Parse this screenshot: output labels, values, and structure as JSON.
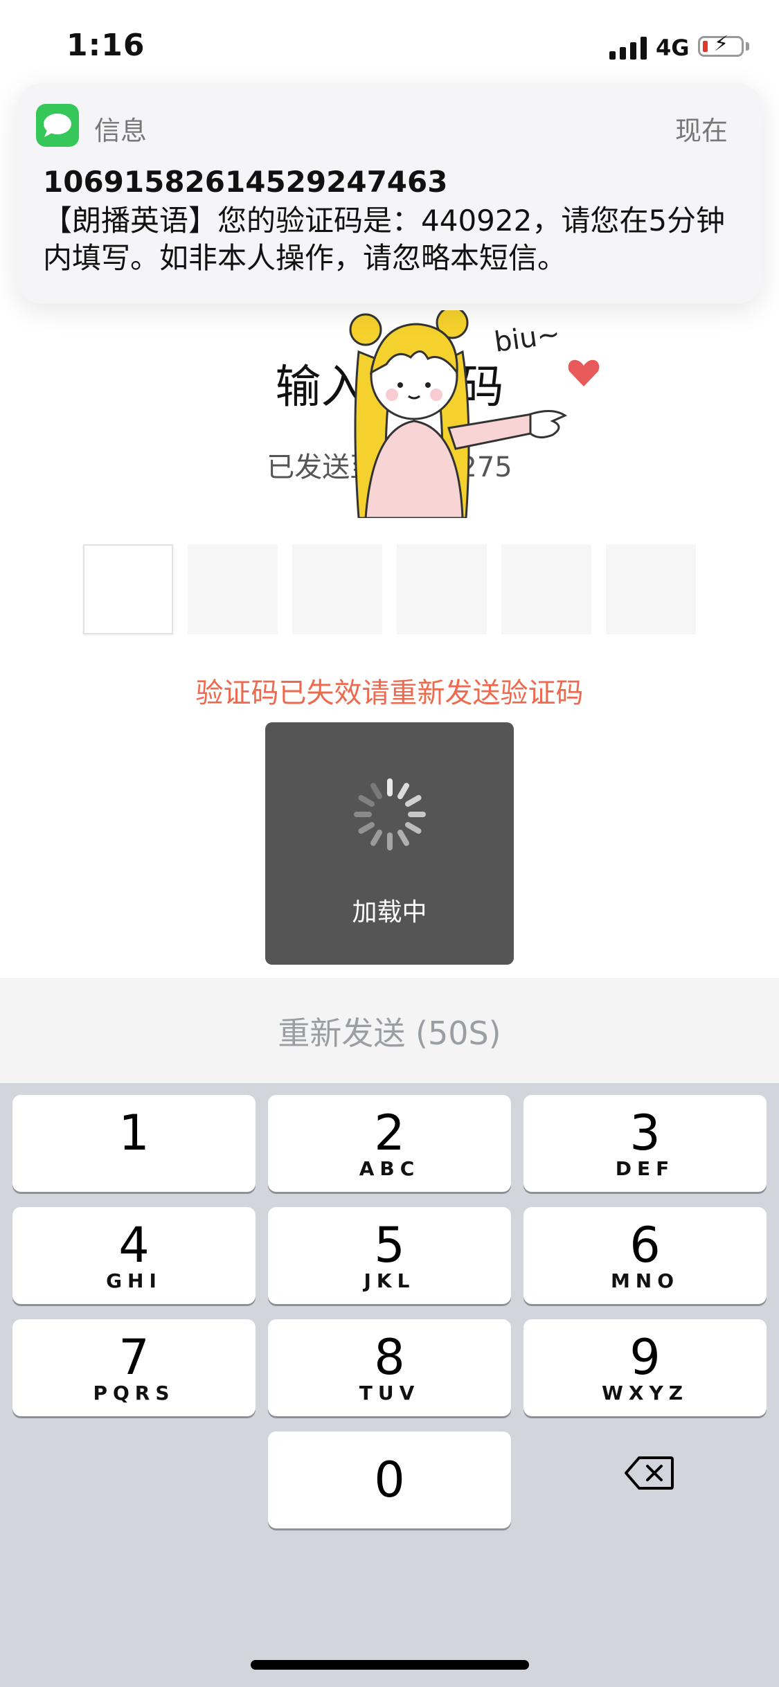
{
  "status_bar": {
    "time": "1:16",
    "network": "4G"
  },
  "notification": {
    "app_name": "信息",
    "time": "现在",
    "sender": "1069158261452924​7463",
    "body": "【朗播英语】您的验证码是：440922，请您在5分钟内填写。如非本人操作，请忽略本短信。"
  },
  "page": {
    "title": "输入验证码",
    "sent_to": "已发送至 ****7275",
    "error": "验证码已失效请重新发送验证码",
    "code_slots": 6
  },
  "sticker": {
    "text": "biu~"
  },
  "loading": {
    "text": "加载中"
  },
  "resend": {
    "label": "重新发送 (50S)"
  },
  "keypad": {
    "keys": [
      {
        "num": "1",
        "letters": ""
      },
      {
        "num": "2",
        "letters": "ABC"
      },
      {
        "num": "3",
        "letters": "DEF"
      },
      {
        "num": "4",
        "letters": "GHI"
      },
      {
        "num": "5",
        "letters": "JKL"
      },
      {
        "num": "6",
        "letters": "MNO"
      },
      {
        "num": "7",
        "letters": "PQRS"
      },
      {
        "num": "8",
        "letters": "TUV"
      },
      {
        "num": "9",
        "letters": "WXYZ"
      },
      {
        "num": "0",
        "letters": ""
      }
    ],
    "delete_icon": "backspace-icon"
  },
  "colors": {
    "error": "#ee6a4e",
    "loading_bg": "#555555",
    "keypad_bg": "#d2d5db",
    "messages_green": "#35c759"
  }
}
